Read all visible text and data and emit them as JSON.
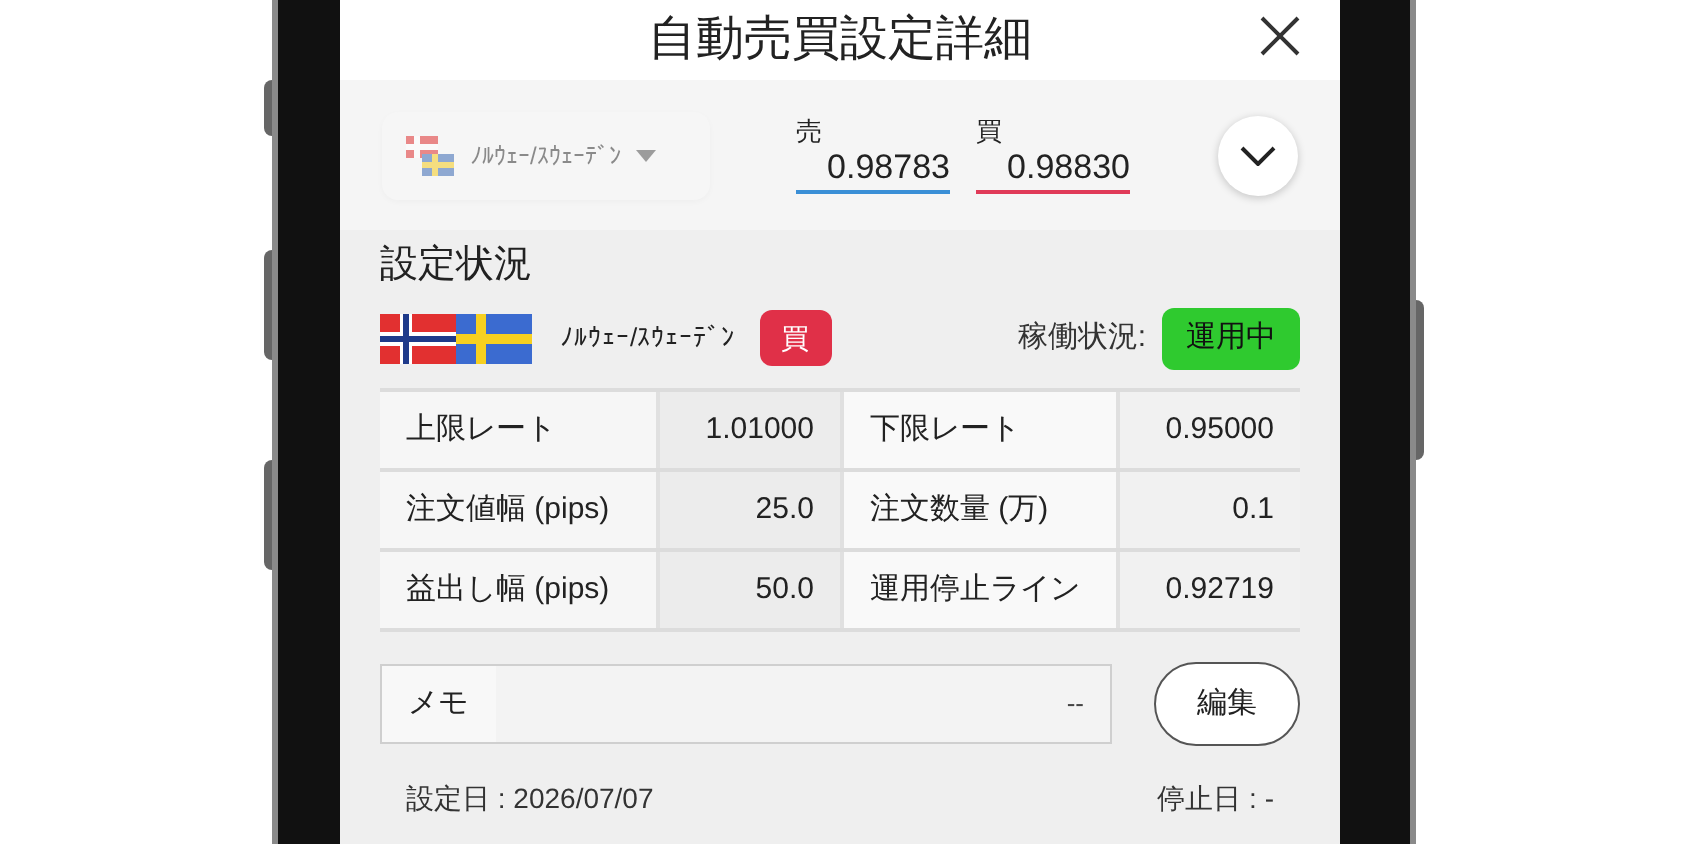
{
  "title": "自動売買設定詳細",
  "pair_selector": {
    "label": "ﾉﾙｳｪｰ/ｽｳｪｰﾃﾞﾝ",
    "disabled": true
  },
  "quotes": [
    {
      "label": "売",
      "value": "0.98783",
      "kind": "sell"
    },
    {
      "label": "買",
      "value": "0.98830",
      "kind": "buy"
    }
  ],
  "section_title": "設定状況",
  "pair": {
    "name": "ﾉﾙｳｪｰ/ｽｳｪｰﾃﾞﾝ",
    "side": "買"
  },
  "status": {
    "label": "稼働状況:",
    "value": "運用中"
  },
  "table": {
    "rows": [
      [
        "上限レート",
        "1.01000",
        "下限レート",
        "0.95000"
      ],
      [
        "注文値幅 (pips)",
        "25.0",
        "注文数量 (万)",
        "0.1"
      ],
      [
        "益出し幅 (pips)",
        "50.0",
        "運用停止ライン",
        "0.92719"
      ]
    ]
  },
  "memo": {
    "label": "メモ",
    "value": "--"
  },
  "edit_button": "編集",
  "set_date": "設定日 : 2026/07/07",
  "stop_date": "停止日 : -"
}
